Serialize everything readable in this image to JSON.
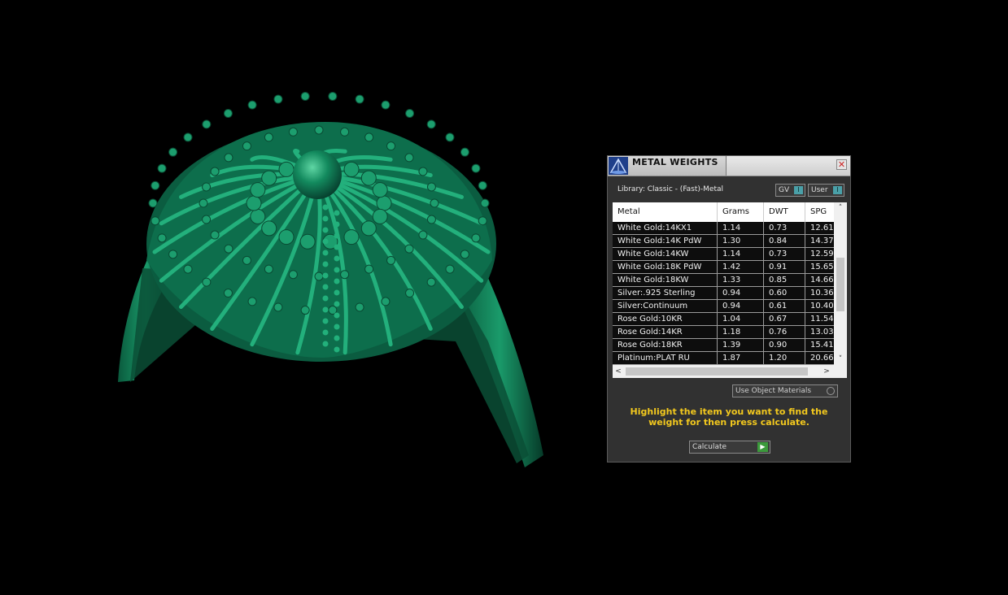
{
  "panel": {
    "title": "METAL WEIGHTS",
    "close_glyph": "✕",
    "library_label": "Library: Classic - (Fast)-Metal",
    "toggles": {
      "gv_label": "GV",
      "user_label": "User",
      "knob_glyph": "I"
    },
    "table": {
      "columns": [
        "Metal",
        "Grams",
        "DWT",
        "SPG"
      ],
      "rows": [
        [
          "White Gold:14KX1",
          "1.14",
          "0.73",
          "12.61"
        ],
        [
          "White Gold:14K PdW",
          "1.30",
          "0.84",
          "14.37"
        ],
        [
          "White Gold:14KW",
          "1.14",
          "0.73",
          "12.59"
        ],
        [
          "White Gold:18K PdW",
          "1.42",
          "0.91",
          "15.65"
        ],
        [
          "White Gold:18KW",
          "1.33",
          "0.85",
          "14.66"
        ],
        [
          "Silver:.925 Sterling",
          "0.94",
          "0.60",
          "10.36"
        ],
        [
          "Silver:Continuum",
          "0.94",
          "0.61",
          "10.40"
        ],
        [
          "Rose Gold:10KR",
          "1.04",
          "0.67",
          "11.54"
        ],
        [
          "Rose Gold:14KR",
          "1.18",
          "0.76",
          "13.03"
        ],
        [
          "Rose Gold:18KR",
          "1.39",
          "0.90",
          "15.41"
        ],
        [
          "Platinum:PLAT RU",
          "1.87",
          "1.20",
          "20.66"
        ]
      ],
      "scroll_up": "˄",
      "scroll_down": "˅",
      "scroll_left": "<",
      "scroll_right": ">"
    },
    "use_object_materials_label": "Use Object Materials",
    "hint": "Highlight the item you want to find the weight for then press calculate.",
    "calculate_label": "Calculate",
    "play_glyph": "▶"
  },
  "colors": {
    "model": "#0e6b4a",
    "hint_text": "#f2c81e",
    "panel_bg": "#313131"
  },
  "icons": {
    "app": "triangle-scale-icon",
    "close": "close-icon",
    "play": "play-icon"
  }
}
